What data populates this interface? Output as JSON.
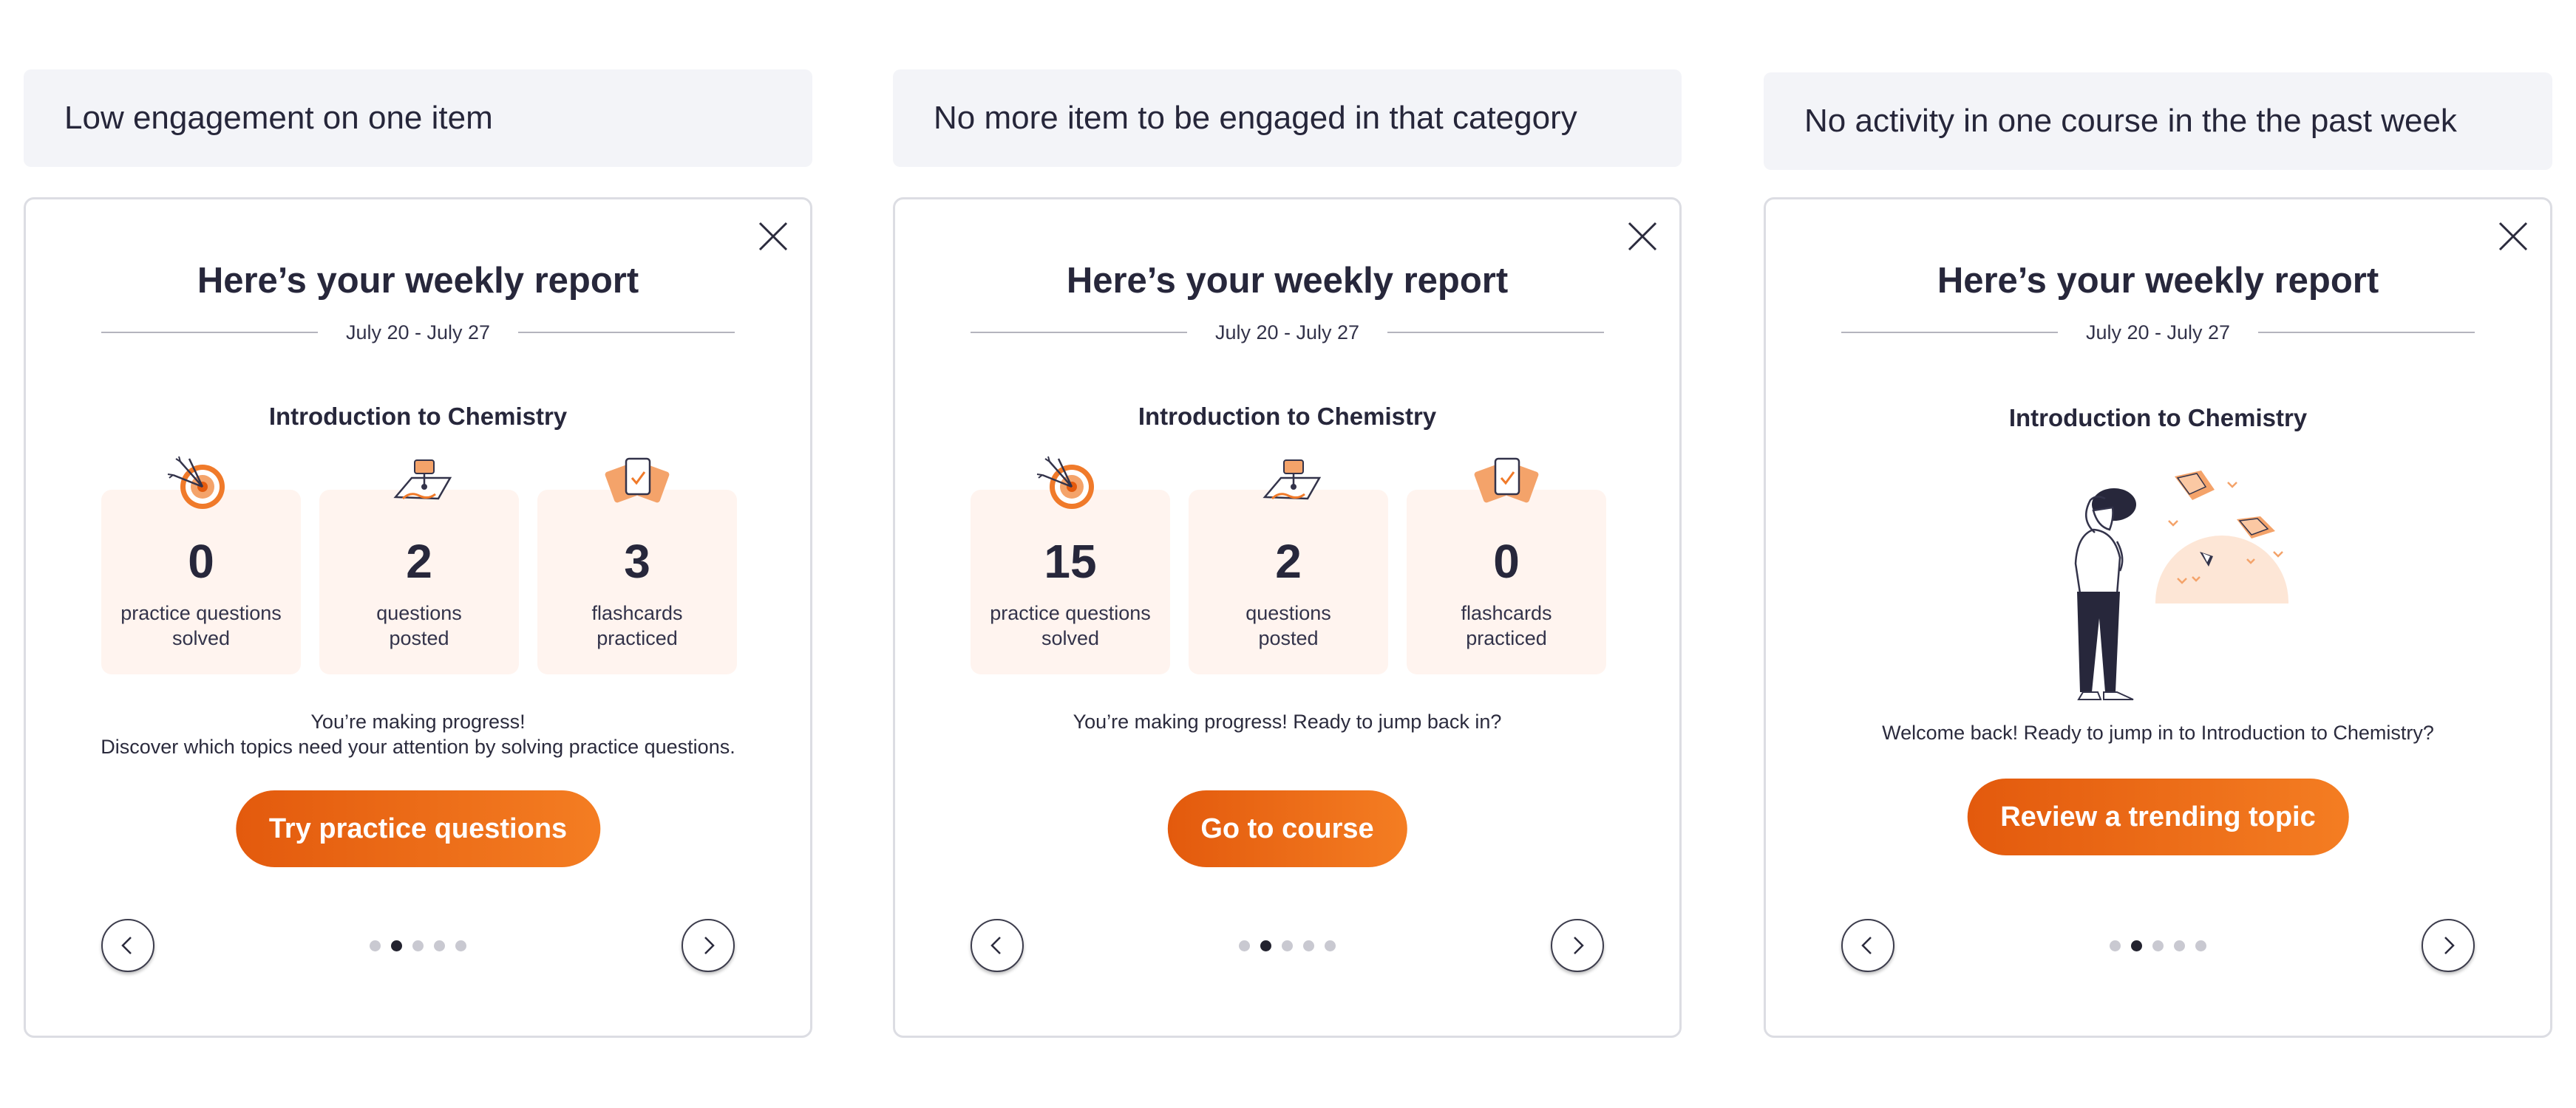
{
  "panels": [
    {
      "banner": "Low engagement on one item",
      "title": "Here’s your weekly report",
      "date_range": "July 20 - July 27",
      "course": "Introduction to Chemistry",
      "stats": [
        {
          "value": "0",
          "label_line1": "practice questions",
          "label_line2": "solved",
          "icon": "target-icon"
        },
        {
          "value": "2",
          "label_line1": "questions",
          "label_line2": "posted",
          "icon": "map-question-icon"
        },
        {
          "value": "3",
          "label_line1": "flashcards",
          "label_line2": "practiced",
          "icon": "flashcards-icon"
        }
      ],
      "message_line1": "You’re making progress!",
      "message_line2": "Discover which topics need your attention by solving practice questions.",
      "cta": "Try practice questions",
      "pager": {
        "total": 5,
        "active_index": 1
      }
    },
    {
      "banner": "No more item to be engaged in that category",
      "title": "Here’s your weekly report",
      "date_range": "July 20 - July 27",
      "course": "Introduction to Chemistry",
      "stats": [
        {
          "value": "15",
          "label_line1": "practice questions",
          "label_line2": "solved",
          "icon": "target-icon"
        },
        {
          "value": "2",
          "label_line1": "questions",
          "label_line2": "posted",
          "icon": "map-question-icon"
        },
        {
          "value": "0",
          "label_line1": "flashcards",
          "label_line2": "practiced",
          "icon": "flashcards-icon"
        }
      ],
      "message_line1": "You’re making progress! Ready to jump back in?",
      "cta": "Go to course",
      "pager": {
        "total": 5,
        "active_index": 1
      }
    },
    {
      "banner": "No activity in one course in the the past week",
      "title": "Here’s your weekly report",
      "date_range": "July 20 - July 27",
      "course": "Introduction to Chemistry",
      "illustration": "person-looking-at-sunrise-illustration",
      "message_line1": "Welcome back! Ready to jump in to Introduction to Chemistry?",
      "cta": "Review a trending topic",
      "pager": {
        "total": 5,
        "active_index": 1
      }
    }
  ],
  "colors": {
    "accent": "#e8630f",
    "stat_bg": "#fff4ef",
    "banner_bg": "#f3f4f8",
    "dot_active": "#23232f",
    "dot_inactive": "#c9c9d1"
  }
}
